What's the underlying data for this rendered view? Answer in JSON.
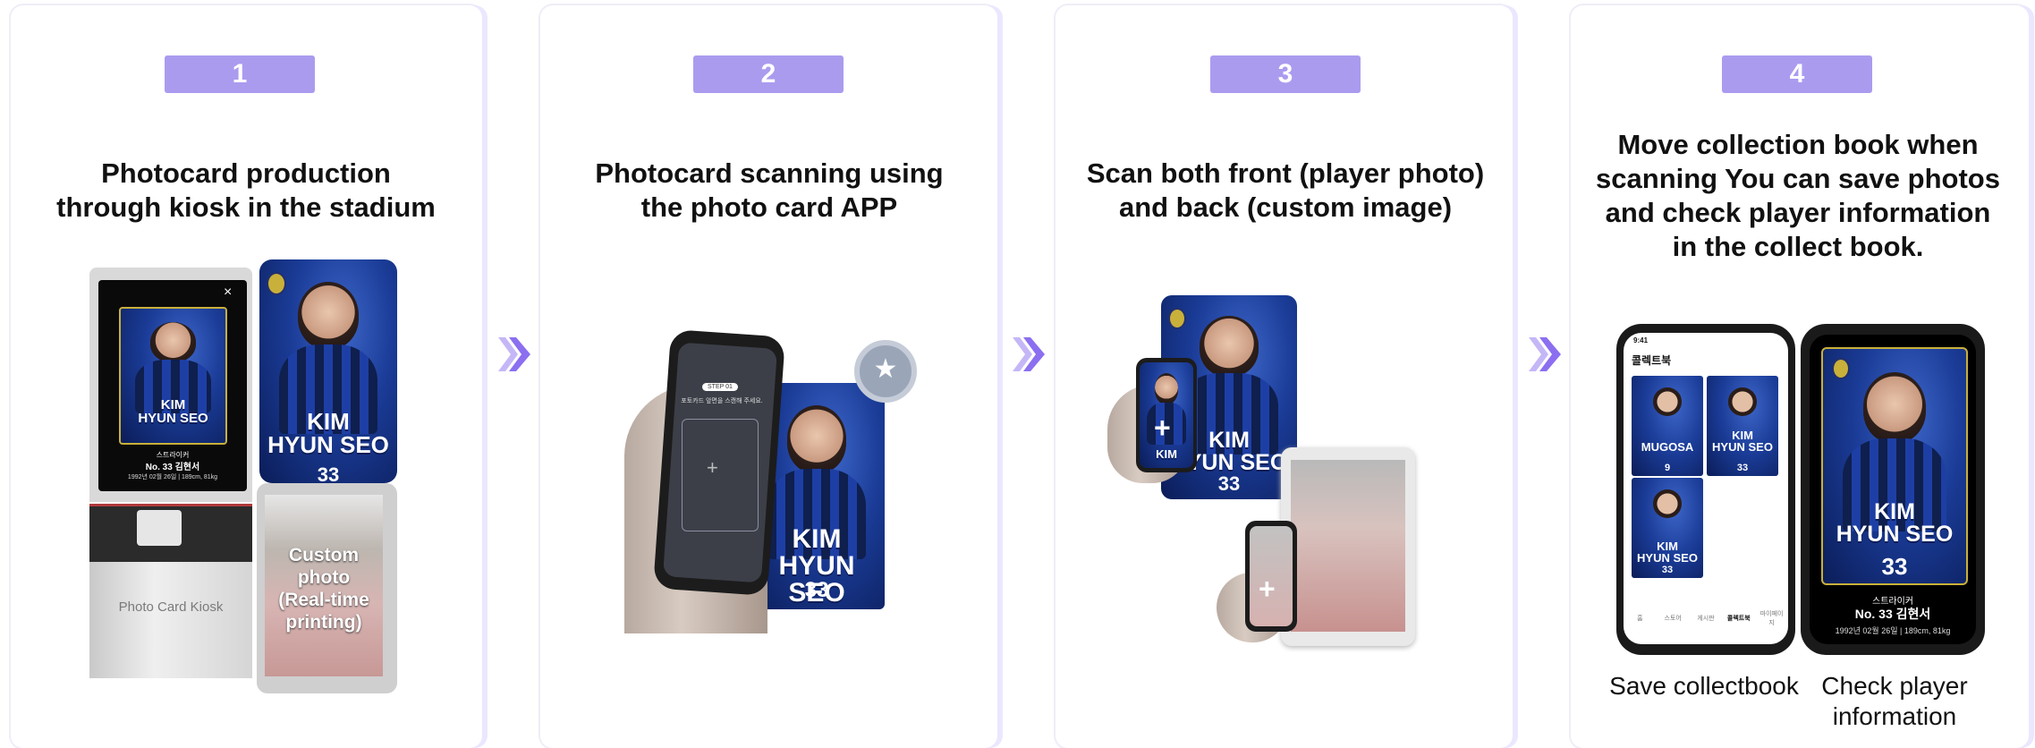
{
  "steps": [
    {
      "number": "1",
      "title_line1": "Photocard production",
      "title_line2": "through kiosk in the stadium"
    },
    {
      "number": "2",
      "title_line1": "Photocard scanning using",
      "title_line2": "the photo card APP"
    },
    {
      "number": "3",
      "title_line1": "Scan both front (player photo)",
      "title_line2": "and back (custom image)"
    },
    {
      "number": "4",
      "title_line1": "Move collection book when",
      "title_line2": "scanning You can save photos",
      "title_line3": "and check player information",
      "title_line4": "in the collect book."
    }
  ],
  "card": {
    "name_line1": "KIM",
    "name_line2": "HYUN SEO",
    "number": "33",
    "bg_text": "KIM HYUN SEO"
  },
  "kiosk": {
    "label": "Photo Card Kiosk",
    "close": "×",
    "position": "스트라이커",
    "player": "No. 33 김현서",
    "info": "1992년 02월 26일 | 189cm, 81kg",
    "custom_line1": "Custom",
    "custom_line2": "photo",
    "custom_line3": "(Real-time",
    "custom_line4": "printing)"
  },
  "scan_app": {
    "pill": "STEP 01",
    "hint": "포토카드 앞면을 스캔해 주세요.",
    "plus": "+"
  },
  "step3": {
    "plus": "+"
  },
  "collectbook": {
    "time": "9:41",
    "title": "콜렉트북",
    "cards": [
      {
        "name_line1": "MUGOSA",
        "number": "9"
      },
      {
        "name_line1": "KIM",
        "name_line2": "HYUN SEO",
        "number": "33"
      },
      {
        "name_line1": "KIM",
        "name_line2": "HYUN SEO",
        "number": "33"
      }
    ],
    "tabs": [
      "홈",
      "스토어",
      "게시판",
      "콜렉트북",
      "마이페이지"
    ]
  },
  "detail": {
    "position": "스트라이커",
    "player": "No. 33 김현서",
    "info": "1992년 02월 26일  |  189cm, 81kg"
  },
  "captions": {
    "save": "Save collectbook",
    "check_line1": "Check player",
    "check_line2": "information"
  },
  "colors": {
    "badge": "#ab9bef",
    "arrow": "#8b6ff0",
    "card_blue": "#1a3b96"
  }
}
